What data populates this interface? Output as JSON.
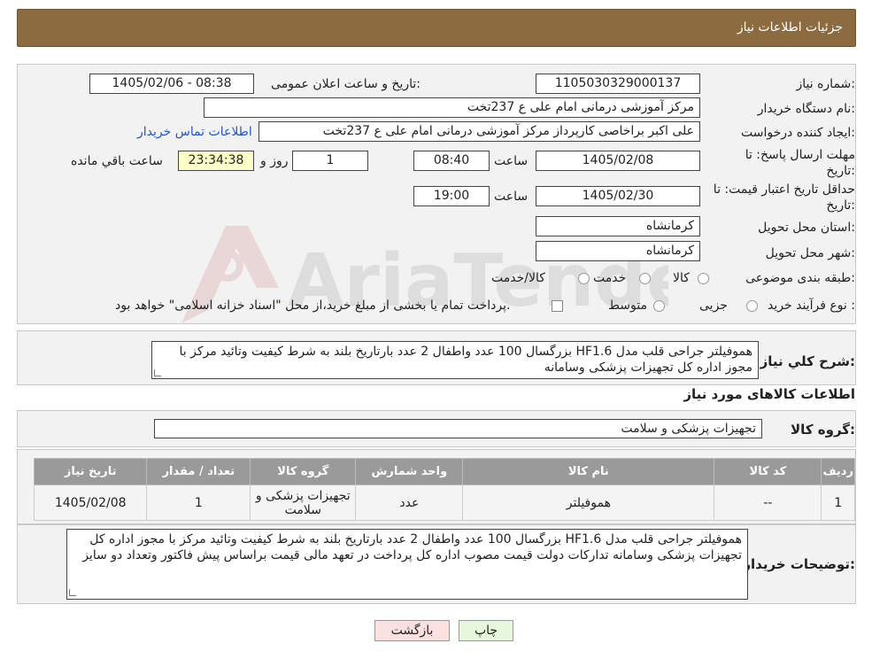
{
  "header": {
    "title": "جزئیات اطلاعات نیاز"
  },
  "form": {
    "need_number_label": "شماره نیاز:",
    "need_number": "1105030329000137",
    "announce_label": "تاریخ و ساعت اعلان عمومی:",
    "announce_value": "1405/02/06 - 08:38",
    "buyer_org_label": "نام دستگاه خریدار:",
    "buyer_org": "مرکز آموزشی درمانی امام علی ع 237تخت",
    "creator_label": "ایجاد کننده درخواست:",
    "creator": "علی اکبر براخاصی کارپرداز  مرکز آموزشی درمانی امام علی ع 237تخت",
    "contact_link": "اطلاعات تماس خریدار",
    "deadline_label_1": "مهلت ارسال پاسخ: تا",
    "deadline_label_2": "تاریخ:",
    "deadline_date": "1405/02/08",
    "time_label": "ساعت",
    "deadline_time": "08:40",
    "days_value": "1",
    "days_label": "روز و",
    "remaining_time": "23:34:38",
    "remaining_label": "ساعت باقي مانده",
    "price_validity_label_1": "حداقل تاریخ اعتبار قیمت: تا",
    "price_validity_label_2": "تاریخ:",
    "price_validity_date": "1405/02/30",
    "price_validity_time": "19:00",
    "province_label": "استان محل تحویل:",
    "province": "کرمانشاه",
    "city_label": "شهر محل تحویل:",
    "city": "کرمانشاه",
    "category_label": "طبقه بندی موضوعی:",
    "category_options": [
      "کالا",
      "خدمت",
      "کالا/خدمت"
    ],
    "purchase_type_label": "نوع فرآیند خرید :",
    "purchase_type_options": [
      "جزیی",
      "متوسط"
    ],
    "purchase_note": "پرداخت تمام یا بخشی از مبلغ خرید،از محل \"اسناد خزانه اسلامی\" خواهد بود."
  },
  "watermark": {
    "text": "AriaTender.neT"
  },
  "summary": {
    "label": "شرح کلي نياز:",
    "text": "هموفیلتر جراحی قلب مدل HF1.6  بزرگسال 100 عدد واطفال 2 عدد بارتاریخ بلند به شرط کیفیت وتائید مرکز با مجوز اداره کل تجهیزات پزشکی وسامانه"
  },
  "goods_section_title": "اطلاعات کالاهای مورد نیاز",
  "goods_group": {
    "label": "گروه کالا:",
    "value": "تجهیزات پزشکی و سلامت"
  },
  "table": {
    "headers": [
      "ردیف",
      "کد کالا",
      "نام کالا",
      "واحد شمارش",
      "گروه کالا",
      "تعداد / مقدار",
      "تاریخ نیاز"
    ],
    "rows": [
      [
        "1",
        "--",
        "هموفیلتر",
        "عدد",
        "تجهیزات پزشکی و سلامت",
        "1",
        "1405/02/08"
      ]
    ]
  },
  "buyer_notes": {
    "label": "توضیحات خریدار:",
    "text": "هموفیلتر جراحی قلب مدل HF1.6  بزرگسال 100 عدد واطفال 2 عدد بارتاریخ بلند به شرط کیفیت وتائید مرکز با مجوز اداره کل تجهیزات پزشکی وسامانه تدارکات دولت قیمت مصوب اداره کل پرداخت در تعهد مالی  قیمت براساس پیش فاکتور وتعداد دو سایز"
  },
  "buttons": {
    "print": "چاپ",
    "back": "بازگشت"
  },
  "colors": {
    "header": "#8b6b3f",
    "table_header": "#9a9a9a",
    "print_btn": "#e6f7dc",
    "back_btn": "#fbe0e0",
    "link": "#2255cc"
  }
}
